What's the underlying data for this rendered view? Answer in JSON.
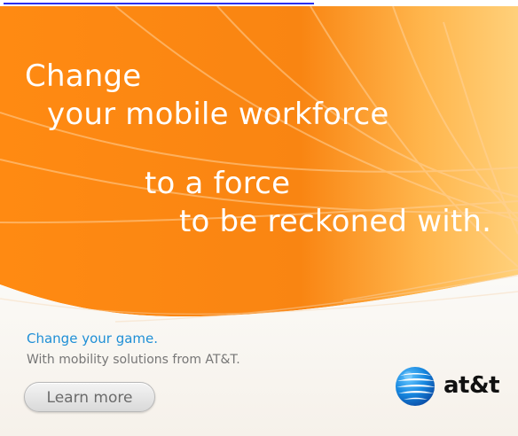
{
  "ad": {
    "headline": {
      "line1": "Change",
      "line2": "your mobile workforce",
      "line3": "to a force",
      "line4": "to be reckoned with."
    },
    "tagline": "Change your game.",
    "subline": "With mobility solutions from AT&T.",
    "cta_label": "Learn more",
    "brand": "at&t",
    "icons": {
      "logo": "att-globe-icon"
    },
    "colors": {
      "orange": "#f77d0a",
      "light_orange": "#ffb24a",
      "background": "#fbf8f3",
      "tagline_blue": "#1f8fd6",
      "subline_gray": "#767676",
      "globe_blue": "#1b8ce0"
    }
  }
}
